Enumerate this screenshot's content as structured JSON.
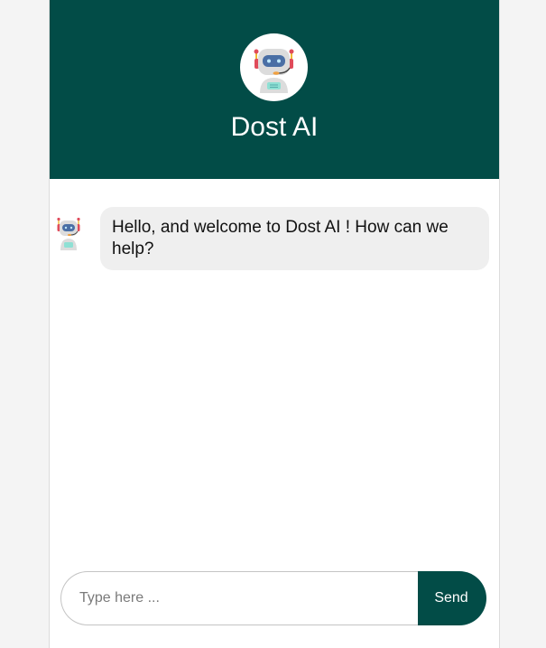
{
  "header": {
    "title": "Dost AI",
    "avatar_icon": "robot-icon"
  },
  "messages": [
    {
      "sender": "bot",
      "avatar_icon": "robot-icon",
      "text": "Hello, and welcome to Dost AI ! How can we help?"
    }
  ],
  "composer": {
    "placeholder": "Type here ...",
    "value": "",
    "send_label": "Send"
  },
  "colors": {
    "brand": "#024c47",
    "page_background": "#f4f4f4",
    "bubble_background": "#efefef"
  }
}
